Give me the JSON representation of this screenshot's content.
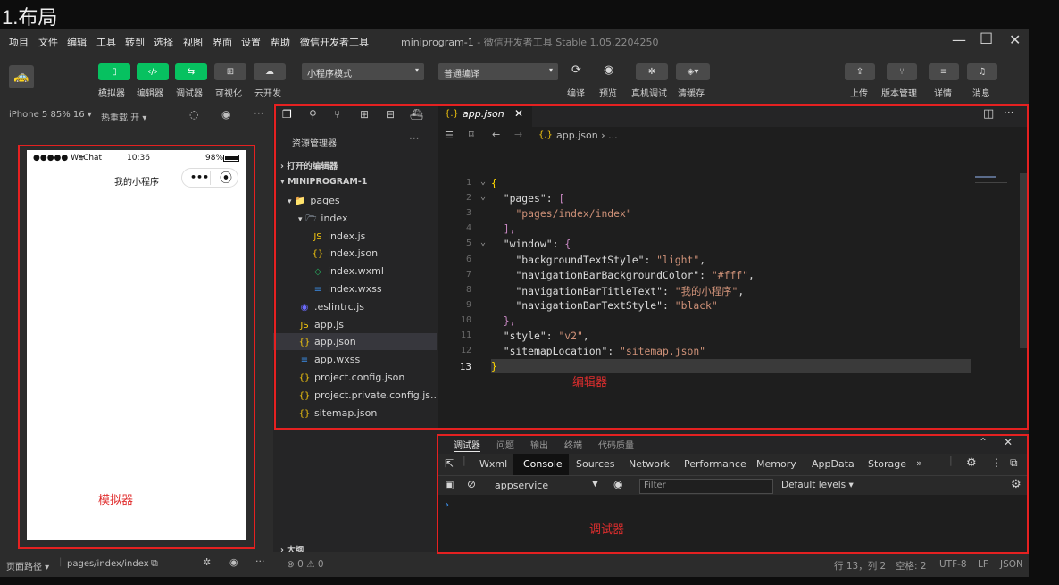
{
  "heading": "1.布局",
  "menu": [
    "项目",
    "文件",
    "编辑",
    "工具",
    "转到",
    "选择",
    "视图",
    "界面",
    "设置",
    "帮助",
    "微信开发者工具"
  ],
  "window_title": {
    "name": "miniprogram-1",
    "sep": " - ",
    "app": "微信开发者工具 Stable 1.05.2204250"
  },
  "toolbar": {
    "left_buttons": [
      {
        "label": "模拟器",
        "glyph": "▯"
      },
      {
        "label": "编辑器",
        "glyph": "‹/›"
      },
      {
        "label": "调试器",
        "glyph": "⇆"
      },
      {
        "label": "可视化",
        "glyph": "⊞"
      },
      {
        "label": "云开发",
        "glyph": "☁"
      }
    ],
    "mode_select": "小程序模式",
    "compile_select": "普通编译",
    "mid_actions": [
      "编译",
      "预览",
      "真机调试",
      "清缓存"
    ],
    "right_actions": [
      "上传",
      "版本管理",
      "详情",
      "消息"
    ]
  },
  "simulator": {
    "device": "iPhone 5 85% 16 ▾",
    "hot_reload": "热重载 开 ▾",
    "status_left": "●●●●● WeChat",
    "status_time": "10:36",
    "status_battery": "98%",
    "nav_title": "我的小程序",
    "capsule_dots": "•••",
    "footer_path_label": "页面路径 ▾",
    "footer_path": "pages/index/index",
    "annotation": "模拟器"
  },
  "explorer": {
    "title": "资源管理器",
    "open_editors": "打开的编辑器",
    "project": "MINIPROGRAM-1",
    "items": [
      {
        "name": "pages",
        "icon": "📁",
        "depth": 1,
        "arrow": "▾",
        "color": "#e8a23b"
      },
      {
        "name": "index",
        "icon": "🗁",
        "depth": 2,
        "arrow": "▾",
        "color": "#9aa7b5"
      },
      {
        "name": "index.js",
        "icon": "JS",
        "depth": 3,
        "color": "#f1c40f"
      },
      {
        "name": "index.json",
        "icon": "{}",
        "depth": 3,
        "color": "#f1c40f"
      },
      {
        "name": "index.wxml",
        "icon": "◇",
        "depth": 3,
        "color": "#27ae60"
      },
      {
        "name": "index.wxss",
        "icon": "≡",
        "depth": 3,
        "color": "#3b8ee8"
      },
      {
        "name": ".eslintrc.js",
        "icon": "◉",
        "depth": 2,
        "color": "#6b6bff"
      },
      {
        "name": "app.js",
        "icon": "JS",
        "depth": 2,
        "color": "#f1c40f"
      },
      {
        "name": "app.json",
        "icon": "{}",
        "depth": 2,
        "color": "#f1c40f"
      },
      {
        "name": "app.wxss",
        "icon": "≡",
        "depth": 2,
        "color": "#3b8ee8"
      },
      {
        "name": "project.config.json",
        "icon": "{}",
        "depth": 2,
        "color": "#f1c40f"
      },
      {
        "name": "project.private.config.js...",
        "icon": "{}",
        "depth": 2,
        "color": "#f1c40f"
      },
      {
        "name": "sitemap.json",
        "icon": "{}",
        "depth": 2,
        "color": "#f1c40f"
      }
    ],
    "outline": "大纲",
    "problems": "⊗ 0 ⚠ 0"
  },
  "editor": {
    "tab": "app.json",
    "breadcrumb": "app.json ›  ...",
    "annotation": "编辑器"
  },
  "debugger": {
    "tabs": [
      "调试器",
      "问题",
      "输出",
      "终端",
      "代码质量"
    ],
    "subtabs": [
      "Wxml",
      "Console",
      "Sources",
      "Network",
      "Performance",
      "Memory",
      "AppData",
      "Storage",
      "»"
    ],
    "context": "appservice",
    "filter_placeholder": "Filter",
    "levels": "Default levels ▾",
    "prompt": "›",
    "annotation": "调试器"
  },
  "statusline": [
    "行 13，列 2",
    "空格: 2",
    "UTF-8",
    "LF",
    "JSON"
  ]
}
